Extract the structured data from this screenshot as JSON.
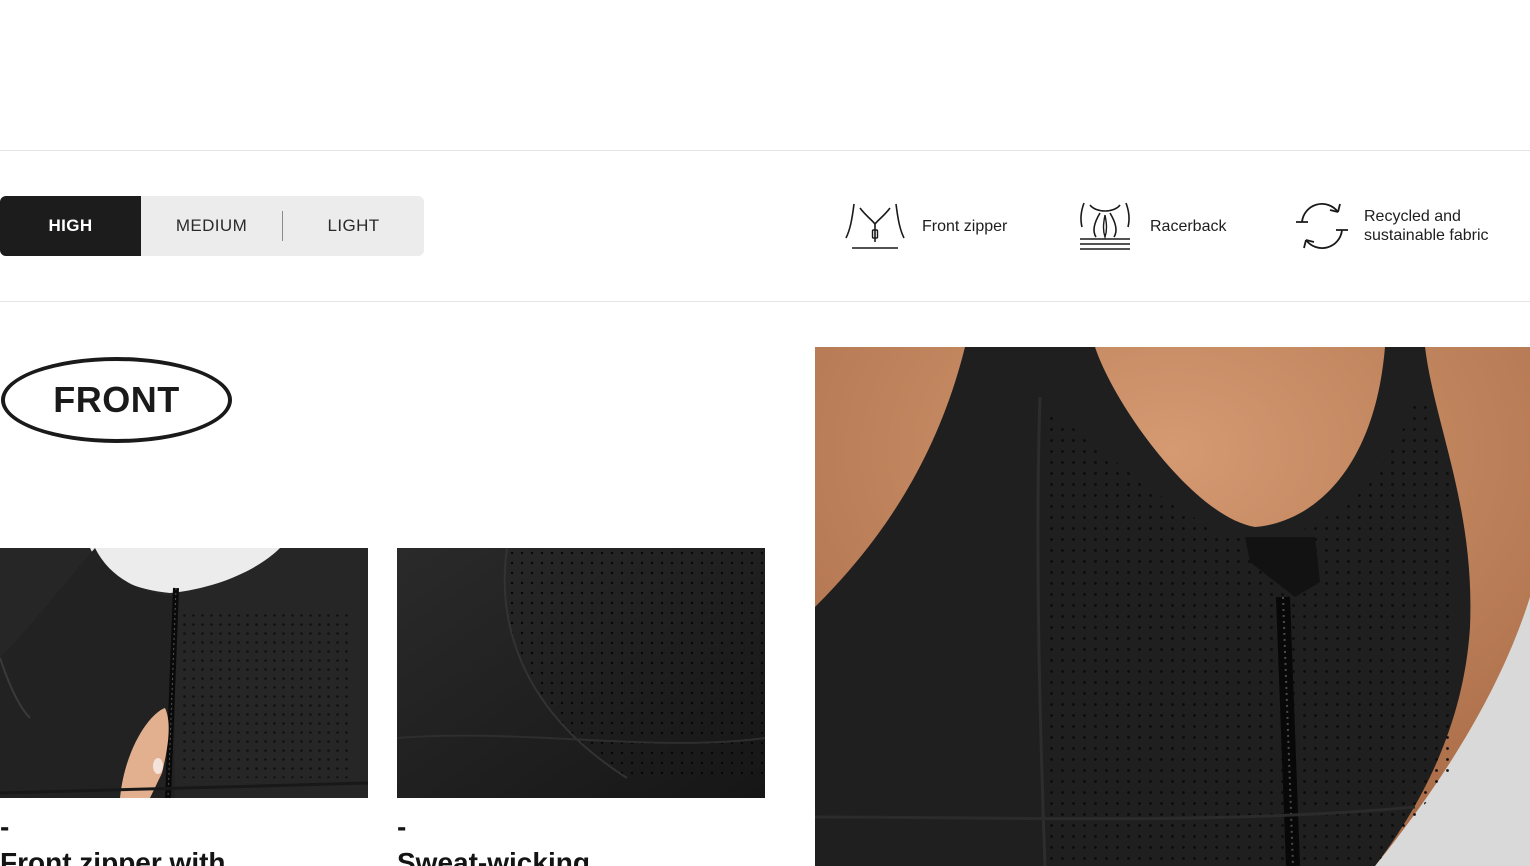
{
  "intensity": {
    "options": [
      {
        "label": "HIGH",
        "active": true
      },
      {
        "label": "MEDIUM",
        "active": false
      },
      {
        "label": "LIGHT",
        "active": false
      }
    ]
  },
  "features": [
    {
      "icon": "front-zipper-icon",
      "label": "Front zipper"
    },
    {
      "icon": "racerback-icon",
      "label": "Racerback"
    },
    {
      "icon": "recycle-icon",
      "label": "Recycled and\nsustainable fabric"
    }
  ],
  "section": {
    "badge": "FRONT"
  },
  "details": [
    {
      "dash": "-",
      "text": "Front zipper with"
    },
    {
      "dash": "-",
      "text": "Sweat-wicking"
    }
  ],
  "colors": {
    "active_bg": "#1c1c1c",
    "control_bg": "#ececec",
    "fabric": "#1f1f1f",
    "skin": "#c98a63"
  }
}
